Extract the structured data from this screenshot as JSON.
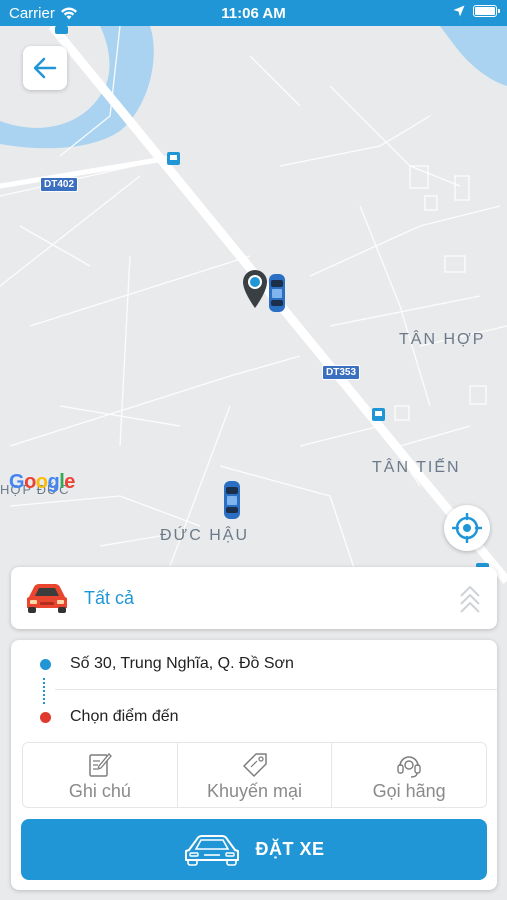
{
  "status_bar": {
    "carrier": "Carrier",
    "time": "11:06 AM"
  },
  "map": {
    "labels": {
      "tan_hop": "TÂN HỢP",
      "tan_tien": "TÂN TIẾN",
      "duc_hau": "ĐỨC HẬU",
      "hop_duc": "HỢP ĐỨC"
    },
    "road_shields": {
      "dt402": "DT402",
      "dt353": "DT353"
    },
    "google_letters": [
      "G",
      "o",
      "o",
      "g",
      "l",
      "e"
    ]
  },
  "vehicle_type": {
    "label": "Tất cả",
    "icon": "red-car-icon"
  },
  "route": {
    "pickup": "Số 30, Trung Nghĩa, Q. Đồ Sơn",
    "destination_placeholder": "Chọn điểm đến"
  },
  "actions": {
    "note": "Ghi chú",
    "promotion": "Khuyến mại",
    "call_company": "Gọi hãng"
  },
  "book_button": {
    "label": "ĐẶT XE"
  },
  "colors": {
    "accent": "#2196d6",
    "pickup_dot": "#2196d6",
    "destination_dot": "#e03a2f",
    "map_bg": "#e9eaec"
  }
}
